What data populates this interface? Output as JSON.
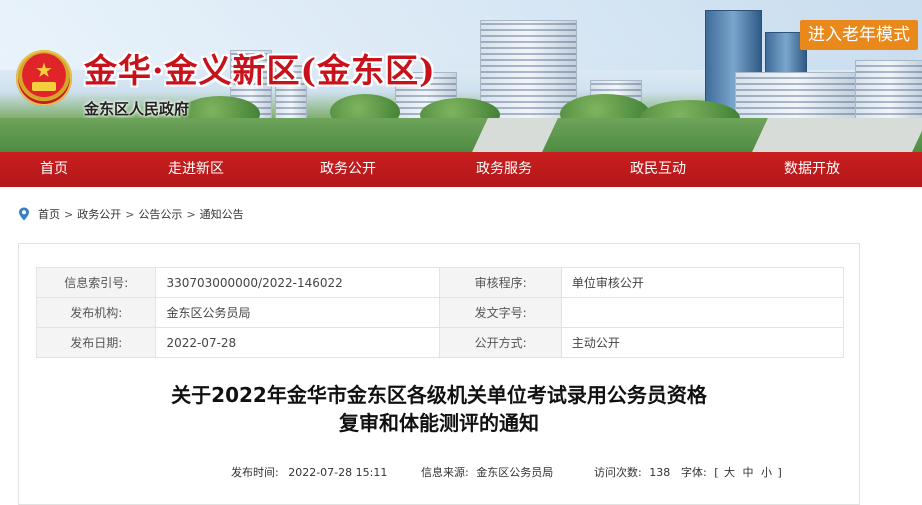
{
  "header": {
    "title": "金华·金义新区(金东区)",
    "subtitle": "金东区人民政府",
    "elder_mode": "进入老年模式"
  },
  "nav": {
    "items": [
      "首页",
      "走进新区",
      "政务公开",
      "政务服务",
      "政民互动",
      "数据开放"
    ]
  },
  "breadcrumb": [
    "首页",
    "政务公开",
    "公告公示",
    "通知公告"
  ],
  "meta": {
    "index_label": "信息索引号:",
    "index_value": "330703000000/2022-146022",
    "review_label": "审核程序:",
    "review_value": "单位审核公开",
    "org_label": "发布机构:",
    "org_value": "金东区公务员局",
    "docno_label": "发文字号:",
    "docno_value": "",
    "date_label": "发布日期:",
    "date_value": "2022-07-28",
    "mode_label": "公开方式:",
    "mode_value": "主动公开"
  },
  "article": {
    "title_line1": "关于2022年金华市金东区各级机关单位考试录用公务员资格",
    "title_line2": "复审和体能测评的通知"
  },
  "info": {
    "time_label": "发布时间:",
    "time_value": "2022-07-28 15:11",
    "source_label": "信息来源:",
    "source_value": "金东区公务员局",
    "visits_label": "访问次数:",
    "visits_value": "138",
    "font_label": "字体:",
    "font_open": "[",
    "font_large": "大",
    "font_medium": "中",
    "font_small": "小",
    "font_close": "]"
  },
  "colors": {
    "nav_red": "#c91f1f",
    "elder_orange": "#e9891c",
    "title_red": "#c8121b"
  },
  "icons": {
    "location": "location-pin-icon",
    "emblem": "national-emblem-icon"
  }
}
